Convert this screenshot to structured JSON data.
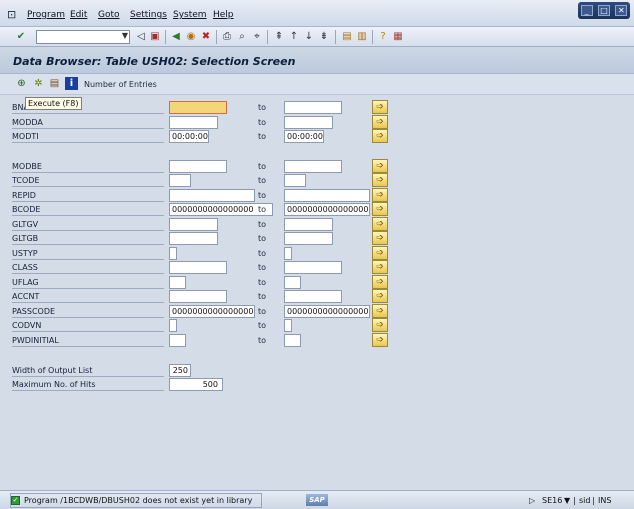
{
  "menu": {
    "items": [
      "Program",
      "Edit",
      "Goto",
      "Settings",
      "System",
      "Help"
    ]
  },
  "toolbar": {
    "command_value": ""
  },
  "title": "Data Browser: Table USH02: Selection Screen",
  "app_toolbar": {
    "number_of_entries": "Number of Entries"
  },
  "tooltip": {
    "text": "Execute   (F8)"
  },
  "selection": {
    "to": "to",
    "rows": [
      {
        "label": "BNAME",
        "from": "",
        "to": ""
      },
      {
        "label": "MODDA",
        "from": "",
        "to": ""
      },
      {
        "label": "MODTI",
        "from": "00:00:00",
        "to": "00:00:00"
      },
      {
        "label": "MODBE",
        "from": "",
        "to": ""
      },
      {
        "label": "TCODE",
        "from": "",
        "to": ""
      },
      {
        "label": "REPID",
        "from": "",
        "to": ""
      },
      {
        "label": "BCODE",
        "from": "0000000000000000",
        "to": "0000000000000000"
      },
      {
        "label": "GLTGV",
        "from": "",
        "to": ""
      },
      {
        "label": "GLTGB",
        "from": "",
        "to": ""
      },
      {
        "label": "USTYP",
        "from": "",
        "to": ""
      },
      {
        "label": "CLASS",
        "from": "",
        "to": ""
      },
      {
        "label": "UFLAG",
        "from": "",
        "to": ""
      },
      {
        "label": "ACCNT",
        "from": "",
        "to": ""
      },
      {
        "label": "PASSCODE",
        "from": "0000000000000000...",
        "to": "0000000000000000..."
      },
      {
        "label": "CODVN",
        "from": "",
        "to": ""
      },
      {
        "label": "PWDINITIAL",
        "from": "",
        "to": ""
      }
    ]
  },
  "output": {
    "width_label": "Width of Output List",
    "width_value": "250",
    "max_hits_label": "Maximum No. of Hits",
    "max_hits_value": "500"
  },
  "status": {
    "message": "Program /1BCDWB/DBUSH02 does not exist yet in library",
    "logo": "SAP",
    "tcode": "SE16",
    "system": "sid",
    "mode": "INS"
  }
}
